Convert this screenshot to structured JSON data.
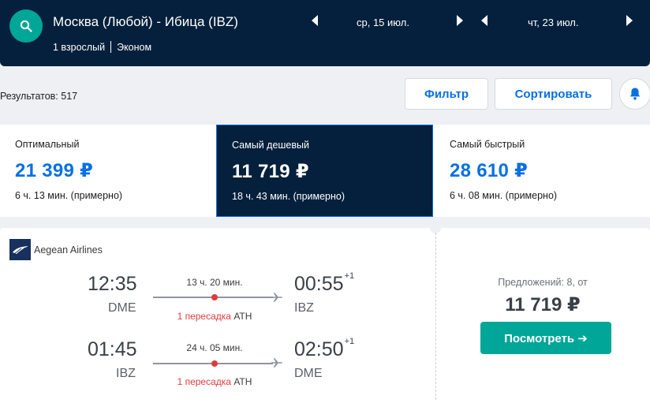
{
  "header": {
    "route": "Москва (Любой) - Ибица (IBZ)",
    "passengers": "1 взрослый",
    "cabin": "Эконом",
    "depart_date": "ср, 15 июл.",
    "return_date": "чт, 23 июл.",
    "icons": {
      "search": "search-icon",
      "prev": "triangle-left-icon",
      "next": "triangle-right-icon"
    }
  },
  "toolbar": {
    "results": "Результатов: 517",
    "filter_label": "Фильтр",
    "sort_label": "Сортировать",
    "bell_icon": "bell-icon"
  },
  "tabs": [
    {
      "label": "Оптимальный",
      "price": "21 399 ₽",
      "duration": "6 ч. 13 мин. (примерно)",
      "active": false
    },
    {
      "label": "Самый дешевый",
      "price": "11 719 ₽",
      "duration": "18 ч. 43 мин. (примерно)",
      "active": true
    },
    {
      "label": "Самый быстрый",
      "price": "28 610 ₽",
      "duration": "6 ч. 08 мин. (примерно)",
      "active": false
    }
  ],
  "result": {
    "airline": "Aegean Airlines",
    "legs": [
      {
        "dep_time": "12:35",
        "dep_code": "DME",
        "duration": "13 ч. 20 мин.",
        "arr_time": "00:55",
        "arr_offset": "+1",
        "arr_code": "IBZ",
        "stops": "1 пересадка",
        "stop_airport": "ATH"
      },
      {
        "dep_time": "01:45",
        "dep_code": "IBZ",
        "duration": "24 ч. 05 мин.",
        "arr_time": "02:50",
        "arr_offset": "+1",
        "arr_code": "DME",
        "stops": "1 пересадка",
        "stop_airport": "ATH"
      }
    ],
    "offers": "Предложений: 8, от",
    "price": "11 719 ₽",
    "view_label": "Посмотреть ➔"
  },
  "colors": {
    "navy": "#05203c",
    "teal": "#00a698",
    "blue": "#0770e3",
    "red": "#e03b3b"
  }
}
